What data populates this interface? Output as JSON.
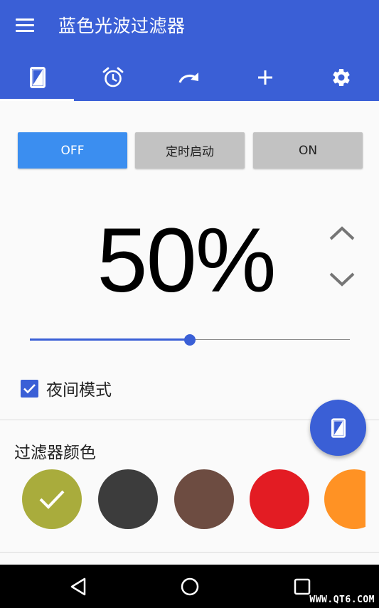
{
  "app": {
    "title": "蓝色光波过滤器",
    "accent_color": "#3a5fd6",
    "menu_icon": "hamburger-menu-icon"
  },
  "tabs": [
    {
      "icon": "phone-filter-icon",
      "selected": true
    },
    {
      "icon": "alarm-clock-icon",
      "selected": false
    },
    {
      "icon": "redo-arrow-icon",
      "selected": false
    },
    {
      "icon": "plus-icon",
      "selected": false
    },
    {
      "icon": "gear-icon",
      "selected": false
    }
  ],
  "mode_buttons": {
    "off_label": "OFF",
    "timer_label": "定时启动",
    "on_label": "ON",
    "selected": "OFF"
  },
  "intensity": {
    "display": "50%",
    "value_percent": 50,
    "up_icon": "chevron-up-icon",
    "down_icon": "chevron-down-icon"
  },
  "night_mode": {
    "label": "夜间模式",
    "checked": true
  },
  "filter_color": {
    "title": "过滤器颜色",
    "swatches": [
      {
        "color": "#a9ac3c",
        "selected": true
      },
      {
        "color": "#3c3c3c",
        "selected": false
      },
      {
        "color": "#6d4c41",
        "selected": false
      },
      {
        "color": "#e31c23",
        "selected": false
      },
      {
        "color": "#ff9224",
        "selected": false
      }
    ]
  },
  "fab": {
    "icon": "phone-filter-icon"
  },
  "system_nav": {
    "back_icon": "back-triangle-icon",
    "home_icon": "home-circle-icon",
    "recents_icon": "recents-square-icon"
  },
  "watermark": "WWW.QT6.COM"
}
